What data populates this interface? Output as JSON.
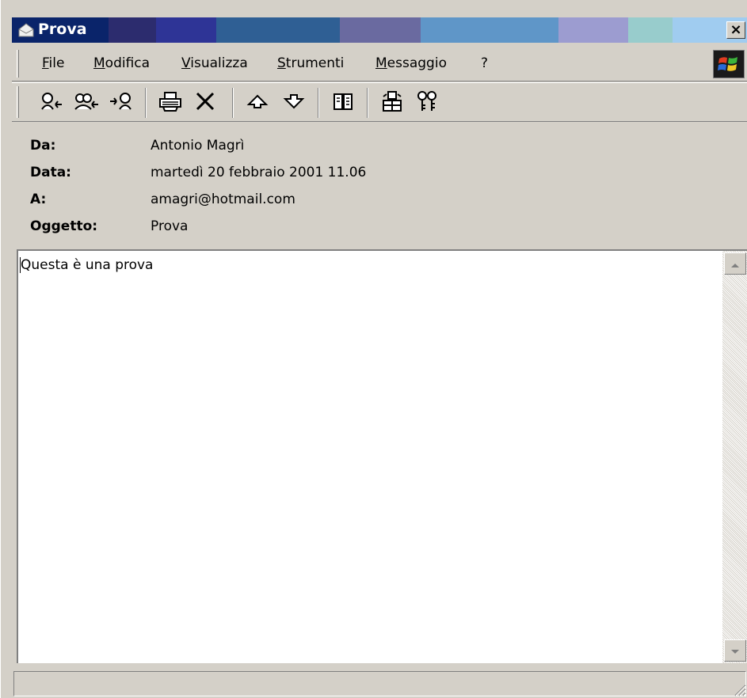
{
  "window": {
    "title": "Prova",
    "close_label": "×",
    "title_colors": [
      "#0a246a",
      "#2c2c6e",
      "#2e3496",
      "#2f5f94",
      "#6a6aa0",
      "#5f96c8",
      "#9c9cd0",
      "#98cccc",
      "#a0ccf0"
    ]
  },
  "menubar": {
    "items": [
      {
        "label": "File"
      },
      {
        "label": "Modifica"
      },
      {
        "label": "Visualizza"
      },
      {
        "label": "Strumenti"
      },
      {
        "label": "Messaggio"
      },
      {
        "label": "?"
      }
    ]
  },
  "toolbar": {
    "buttons": [
      {
        "icon": "reply-icon"
      },
      {
        "icon": "reply-all-icon"
      },
      {
        "icon": "forward-icon"
      },
      {
        "icon": "print-icon"
      },
      {
        "icon": "delete-icon"
      },
      {
        "icon": "previous-icon"
      },
      {
        "icon": "next-icon"
      },
      {
        "icon": "address-book-icon"
      },
      {
        "icon": "encode-icon"
      },
      {
        "icon": "security-icon"
      }
    ]
  },
  "headers": {
    "from_label": "Da:",
    "from_value": "Antonio Magrì",
    "date_label": "Data:",
    "date_value": "martedì 20 febbraio 2001 11.06",
    "to_label": "A:",
    "to_value": "amagri@hotmail.com",
    "subject_label": "Oggetto:",
    "subject_value": "Prova"
  },
  "message": {
    "body": "Questa è una prova"
  },
  "statusbar": {
    "text": ""
  }
}
